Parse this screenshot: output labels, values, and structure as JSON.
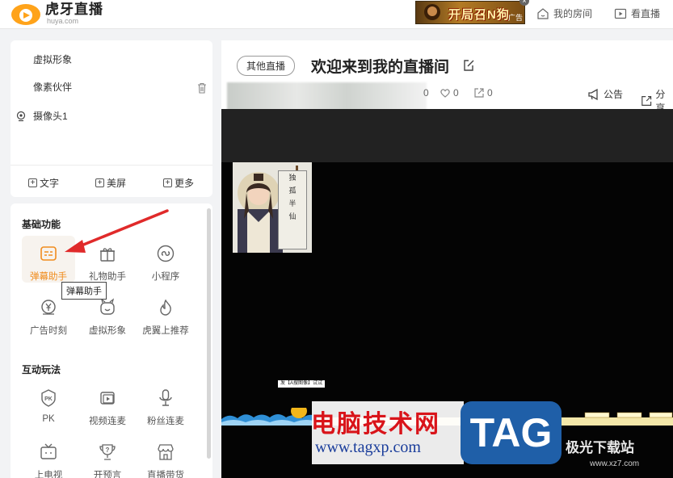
{
  "app": {
    "name": "虎牙直播",
    "sub": "huya.com"
  },
  "ad": {
    "text": "开局召N狗",
    "tag": "广告",
    "close": "×"
  },
  "header": {
    "my_room": "我的房间",
    "watch": "看直播"
  },
  "sources": {
    "items": [
      "虚拟形象",
      "像素伙伴",
      "摄像头1"
    ]
  },
  "tools": {
    "text": "文字",
    "beauty": "美屏",
    "more": "更多"
  },
  "sections": {
    "basic": {
      "title": "基础功能",
      "items": [
        "弹幕助手",
        "礼物助手",
        "小程序",
        "广告时刻",
        "虚拟形象",
        "虎翼上推荐"
      ]
    },
    "interactive": {
      "title": "互动玩法",
      "items": [
        "PK",
        "视频连麦",
        "粉丝连麦",
        "上电视",
        "开预言",
        "直播带货"
      ]
    }
  },
  "tooltip": "弹幕助手",
  "room": {
    "other_live": "其他直播",
    "title": "欢迎来到我的直播间",
    "stats": [
      "0",
      "0",
      "0"
    ],
    "notice": "公告",
    "share": "分享"
  },
  "preview": {
    "banner_chars": [
      "独",
      "孤",
      "半",
      "仙"
    ],
    "small_label": "发【A搜图像】试试"
  },
  "watermark": {
    "cn": "电脑技术网",
    "url": "www.tagxp.com",
    "tag": "TAG",
    "site": "极光下载站",
    "site_url": "www.xz7.com"
  },
  "colors": {
    "accent": "#f08c1e",
    "arrow": "#e02a2a",
    "logo": "#ffa31a"
  }
}
